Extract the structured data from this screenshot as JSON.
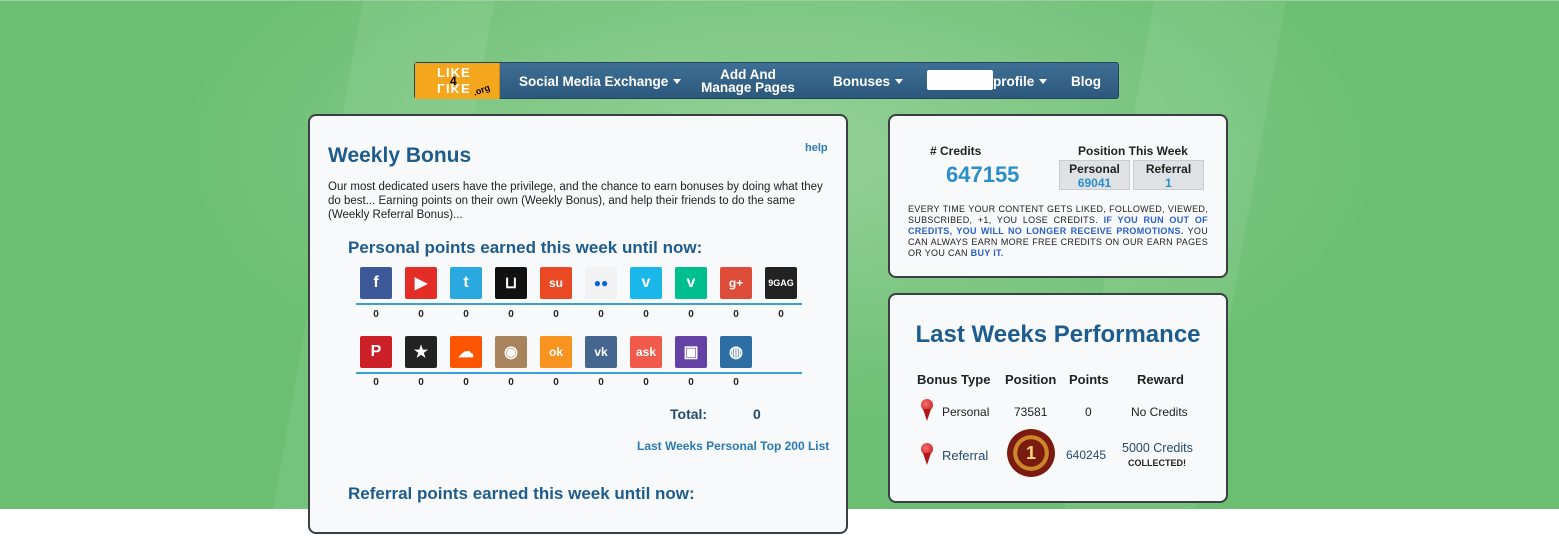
{
  "nav": {
    "logo_text_top": "LIKE",
    "logo_text_num": "4",
    "logo_text_bottom": "LIKE",
    "logo_suffix": ".org",
    "items": [
      {
        "label": "Social Media Exchange",
        "has_dropdown": true
      },
      {
        "label_line1": "Add And",
        "label_line2": "Manage Pages",
        "has_dropdown": false
      },
      {
        "label": "Bonuses",
        "has_dropdown": true
      },
      {
        "label": "profile",
        "has_dropdown": true
      },
      {
        "label": "Blog",
        "has_dropdown": false
      }
    ]
  },
  "weekly": {
    "title": "Weekly Bonus",
    "help": "help",
    "intro": "Our most dedicated users have the privilege, and the chance to earn bonuses by doing what they do best... Earning points on their own (Weekly Bonus), and help their friends to do the same (Weekly Referral Bonus)...",
    "personal_title": "Personal points earned this week until now:",
    "row1": [
      {
        "icon": "facebook-icon",
        "glyph": "f",
        "color": "#3b5998",
        "points": "0"
      },
      {
        "icon": "youtube-icon",
        "glyph": "▶",
        "color": "#e52d27",
        "points": "0"
      },
      {
        "icon": "twitter-icon",
        "glyph": "t",
        "color": "#2aa9e0",
        "points": "0"
      },
      {
        "icon": "audiomack-icon",
        "glyph": "⊔",
        "color": "#111111",
        "points": "0"
      },
      {
        "icon": "stumbleupon-icon",
        "glyph": "su",
        "color": "#eb4924",
        "points": "0"
      },
      {
        "icon": "flickr-icon",
        "glyph": "●●",
        "color": "#f2f2f2",
        "points": "0"
      },
      {
        "icon": "vimeo-icon",
        "glyph": "v",
        "color": "#1ab7ea",
        "points": "0"
      },
      {
        "icon": "vine-icon",
        "glyph": "v",
        "color": "#00bf8f",
        "points": "0"
      },
      {
        "icon": "google-plus-icon",
        "glyph": "g+",
        "color": "#dd4b39",
        "points": "0"
      },
      {
        "icon": "9gag-icon",
        "glyph": "9GAG",
        "color": "#222222",
        "points": "0"
      }
    ],
    "row2": [
      {
        "icon": "pinterest-icon",
        "glyph": "P",
        "color": "#cb2027",
        "points": "0"
      },
      {
        "icon": "reverbnation-icon",
        "glyph": "★",
        "color": "#222222",
        "points": "0"
      },
      {
        "icon": "soundcloud-icon",
        "glyph": "☁",
        "color": "#ff5500",
        "points": "0"
      },
      {
        "icon": "instagram-icon",
        "glyph": "◉",
        "color": "#a8835c",
        "points": "0"
      },
      {
        "icon": "odnoklassniki-icon",
        "glyph": "ok",
        "color": "#f7931e",
        "points": "0"
      },
      {
        "icon": "vk-icon",
        "glyph": "vk",
        "color": "#45668e",
        "points": "0"
      },
      {
        "icon": "askfm-icon",
        "glyph": "ask",
        "color": "#f25a4b",
        "points": "0"
      },
      {
        "icon": "twitch-icon",
        "glyph": "▣",
        "color": "#6441a5",
        "points": "0"
      },
      {
        "icon": "globe-icon",
        "glyph": "◍",
        "color": "#2d6fa5",
        "points": "0"
      }
    ],
    "total_label": "Total:",
    "total_value": "0",
    "top_list_link": "Last Weeks Personal Top 200 List",
    "referral_title": "Referral points earned this week until now:"
  },
  "credits": {
    "label": "# Credits",
    "value": "647155",
    "position_label": "Position This Week",
    "personal_label": "Personal",
    "personal_value": "69041",
    "referral_label": "Referral",
    "referral_value": "1",
    "note_1": "EVERY TIME YOUR CONTENT GETS LIKED, FOLLOWED, VIEWED, SUBSCRIBED, +1, YOU LOSE CREDITS.",
    "note_2": "IF YOU RUN OUT OF CREDITS, YOU WILL NO LONGER RECEIVE PROMOTIONS.",
    "note_3": "YOU CAN ALWAYS EARN MORE FREE CREDITS ON OUR EARN PAGES OR YOU CAN",
    "note_link": "BUY IT."
  },
  "performance": {
    "title": "Last Weeks Performance",
    "headers": {
      "bonus_type": "Bonus Type",
      "position": "Position",
      "points": "Points",
      "reward": "Reward"
    },
    "personal": {
      "type": "Personal",
      "position": "73581",
      "points": "0",
      "reward": "No Credits"
    },
    "referral": {
      "type": "Referral",
      "position_medal": "1",
      "points": "640245",
      "reward": "5000 Credits",
      "status": "COLLECTED!"
    }
  }
}
